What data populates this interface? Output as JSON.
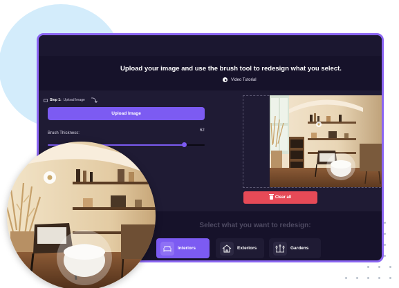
{
  "heading": "Upload your image and use the brush tool to redesign what you select.",
  "video_tutorial": "Video Tutorial",
  "step": {
    "prefix": "Step 1:",
    "label": "Upload Image"
  },
  "upload_button": "Upload Image",
  "brush": {
    "label": "Brush Thickness:",
    "value": "62",
    "level_fraction": 0.87
  },
  "clear_button": "Clear all",
  "select_title": "Select what you want to redesign:",
  "categories": [
    {
      "label": "Interiors",
      "icon": "sofa-icon",
      "active": true
    },
    {
      "label": "Exteriors",
      "icon": "house-icon",
      "active": false
    },
    {
      "label": "Gardens",
      "icon": "plants-icon",
      "active": false
    }
  ],
  "colors": {
    "accent": "#7c5bf2",
    "danger": "#e64a57",
    "frame": "#8b65f3",
    "bg": "#16122a",
    "blob": "#d3ecfb"
  }
}
